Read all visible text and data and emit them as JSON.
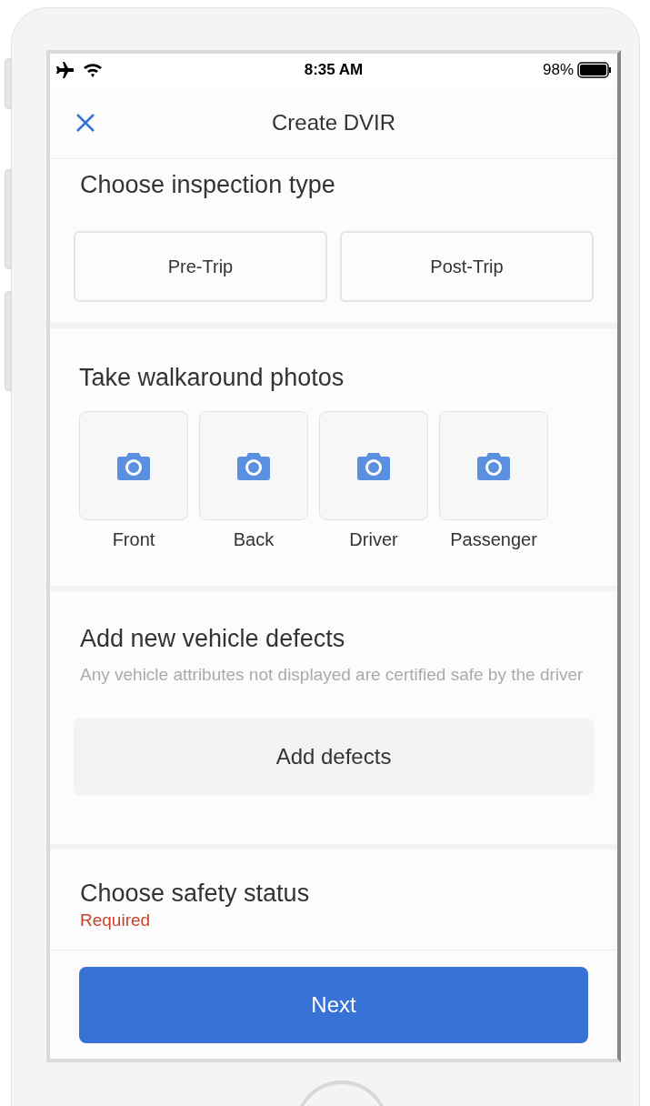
{
  "status_bar": {
    "time": "8:35 AM",
    "battery": "98%"
  },
  "header": {
    "title": "Create DVIR"
  },
  "inspection": {
    "title": "Choose inspection type",
    "types": [
      {
        "label": "Pre-Trip",
        "selected": false
      },
      {
        "label": "Post-Trip",
        "selected": false
      }
    ]
  },
  "photos": {
    "title": "Take walkaround photos",
    "items": [
      "Front",
      "Back",
      "Driver",
      "Passenger"
    ]
  },
  "defects": {
    "title": "Add new vehicle defects",
    "subtitle": "Any vehicle attributes not displayed are certified safe by the driver",
    "button": "Add defects"
  },
  "safety": {
    "title": "Choose safety status",
    "required": "Required"
  },
  "footer": {
    "button": "Next"
  }
}
